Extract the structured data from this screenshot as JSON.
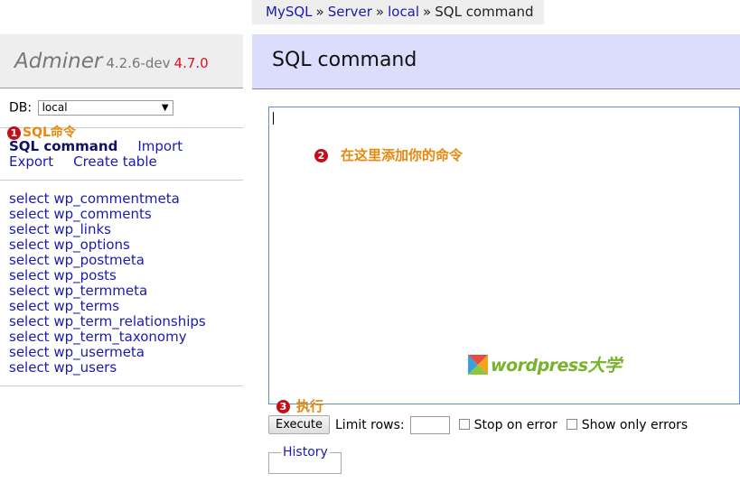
{
  "breadcrumb": {
    "items": [
      "MySQL",
      "Server",
      "local"
    ],
    "current": "SQL command",
    "separator": "»"
  },
  "brand": {
    "name": "Adminer",
    "version": "4.2.6-dev",
    "new_version": "4.7.0"
  },
  "db": {
    "label": "DB:",
    "selected": "local"
  },
  "annotations": {
    "a1": {
      "num": "1",
      "text": "SQL命令"
    },
    "a2": {
      "num": "2",
      "text": "在这里添加你的命令"
    },
    "a3": {
      "num": "3",
      "text": "执行"
    }
  },
  "links": {
    "sql_command": "SQL command",
    "import": "Import",
    "export": "Export",
    "create_table": "Create table"
  },
  "tables": [
    "select wp_commentmeta",
    "select wp_comments",
    "select wp_links",
    "select wp_options",
    "select wp_postmeta",
    "select wp_posts",
    "select wp_termmeta",
    "select wp_terms",
    "select wp_term_relationships",
    "select wp_term_taxonomy",
    "select wp_usermeta",
    "select wp_users"
  ],
  "content": {
    "title": "SQL command",
    "query_value": ""
  },
  "form": {
    "execute": "Execute",
    "limit_label": "Limit rows:",
    "limit_value": "",
    "stop_on_error": "Stop on error",
    "show_only_errors": "Show only errors",
    "history": "History"
  },
  "watermark": {
    "text": "wordpress大学",
    "logo_icon": "wordpress-daxue-logo-icon"
  },
  "colors": {
    "annotation": "#e8870b",
    "badge": "#c0111a",
    "link": "#1a1ab0",
    "header_bg": "#dcdcfc"
  }
}
